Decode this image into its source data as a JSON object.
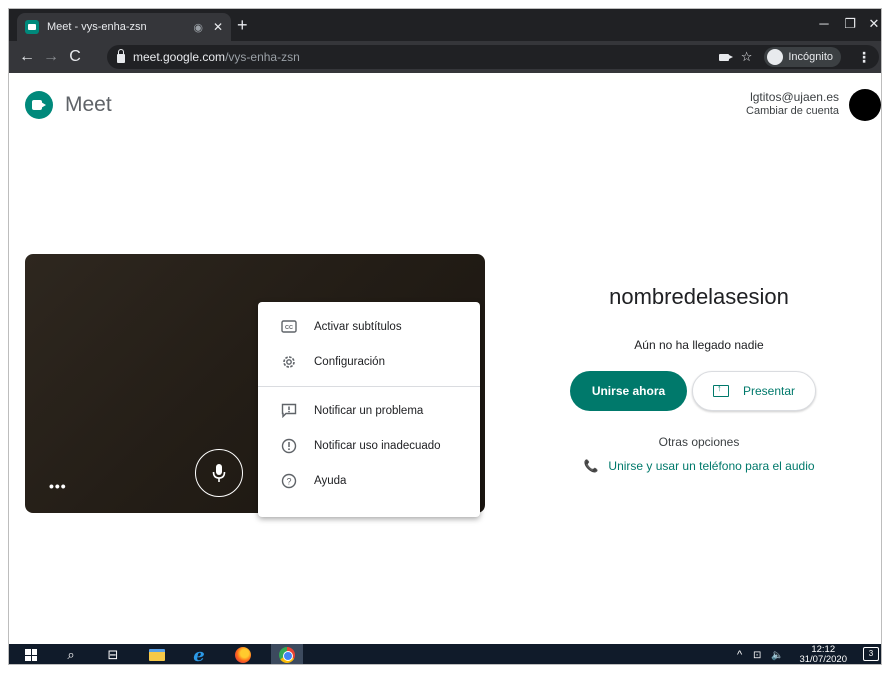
{
  "browser": {
    "tab_title": "Meet - vys-enha-zsn",
    "tab_record_icon": "◉",
    "tab_close": "✕",
    "new_tab": "+",
    "minimize": "─",
    "restore": "❐",
    "close": "✕",
    "url_host": "meet.google.com",
    "url_path": "/vys-enha-zsn",
    "incognito_label": "Incógnito"
  },
  "meet": {
    "logo_text": "Meet",
    "account_email": "lgtitos@ujaen.es",
    "account_switch": "Cambiar de cuenta"
  },
  "preview": {
    "more_options": "•••"
  },
  "menu": {
    "items": [
      {
        "label": "Activar subtítulos",
        "icon": "closed-captions-icon"
      },
      {
        "label": "Configuración",
        "icon": "settings-gear-icon"
      },
      {
        "label": "Notificar un problema",
        "icon": "feedback-icon"
      },
      {
        "label": "Notificar uso inadecuado",
        "icon": "report-abuse-icon"
      },
      {
        "label": "Ayuda",
        "icon": "help-icon"
      }
    ]
  },
  "join": {
    "session_name": "nombredelasesion",
    "status": "Aún no ha llegado nadie",
    "join_now": "Unirse ahora",
    "present": "Presentar",
    "other_options": "Otras opciones",
    "phone_audio": "Unirse y usar un teléfono para el audio"
  },
  "taskbar": {
    "time": "12:12",
    "date": "31/07/2020",
    "notifications": "3",
    "tray_chevron": "^",
    "volume": "🔈"
  },
  "colors": {
    "accent": "#00796b",
    "chrome_dark": "#202124",
    "taskbar": "#101b2a"
  }
}
